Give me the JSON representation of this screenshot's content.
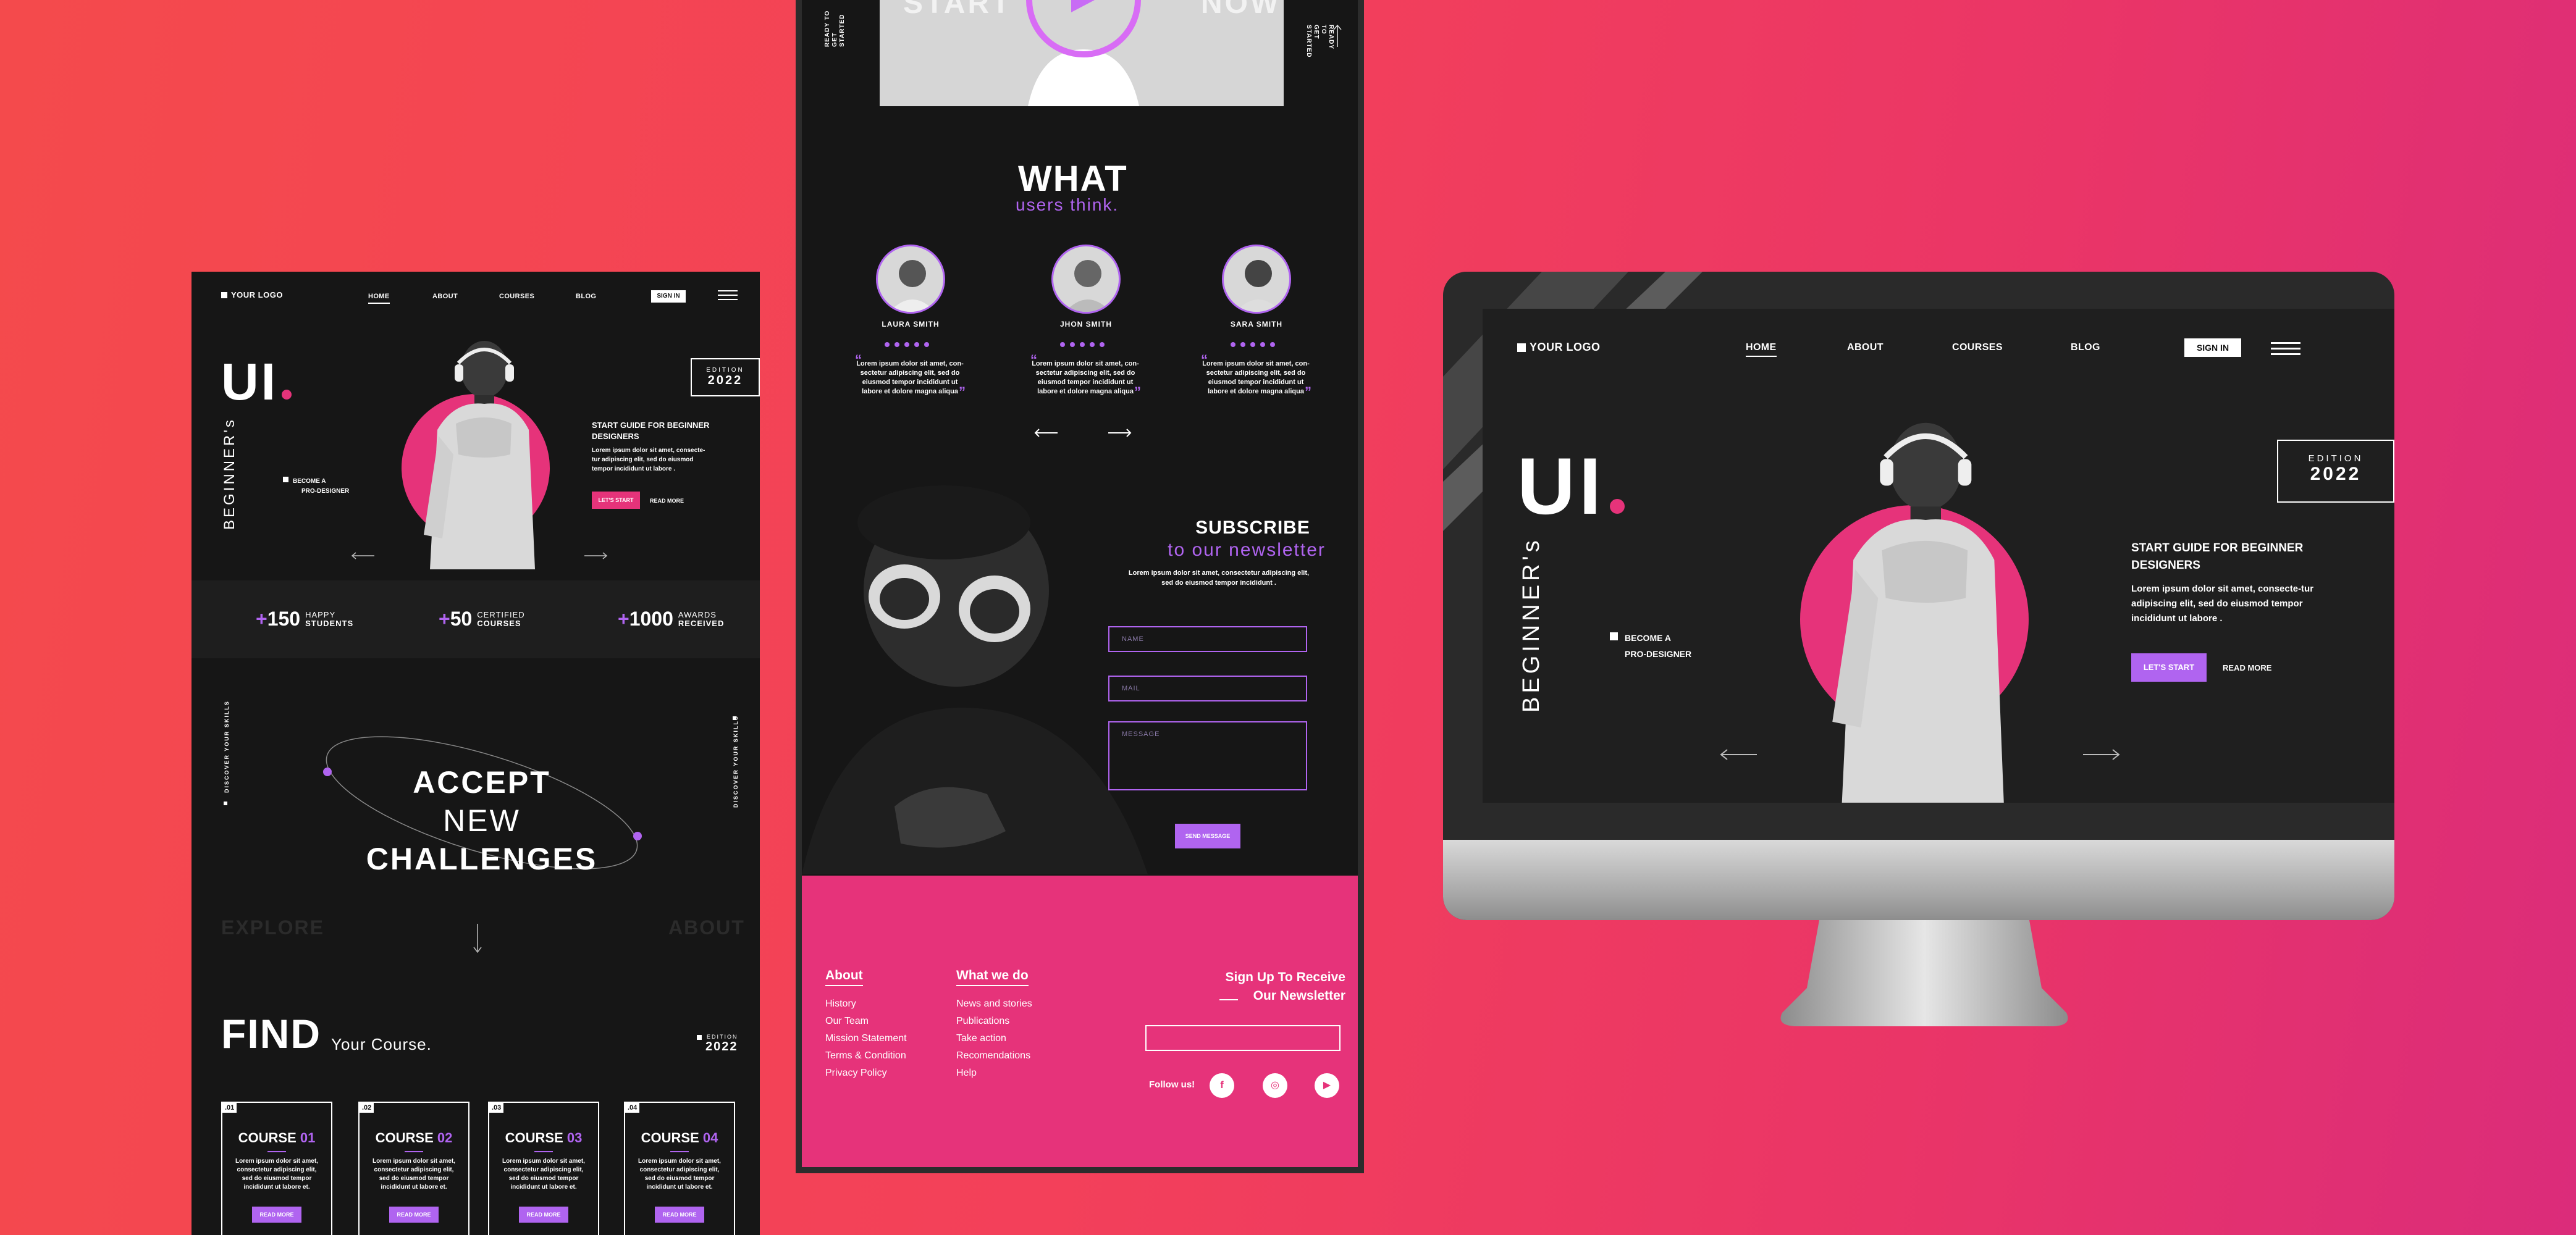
{
  "left": {
    "logo": "YOUR LOGO",
    "nav": [
      "HOME",
      "ABOUT",
      "COURSES",
      "BLOG"
    ],
    "signin": "SIGN IN",
    "hero_title": "UI",
    "vertical_text": "BEGINNER's",
    "become": [
      "BECOME A",
      "PRO-DESIGNER"
    ],
    "edition_label": "EDITION",
    "edition_year": "2022",
    "guide_title": "START GUIDE FOR BEGINNER DESIGNERS",
    "guide_text": "Lorem ipsum dolor sit amet, consecte-tur adipiscing elit, sed do eiusmod tempor incididunt ut labore .",
    "lets_start": "LET'S START",
    "read_more": "READ MORE",
    "stats": [
      {
        "num": "150",
        "l1": "HAPPY",
        "l2": "STUDENTS"
      },
      {
        "num": "50",
        "l1": "CERTIFIED",
        "l2": "COURSES"
      },
      {
        "num": "1000",
        "l1": "AWARDS",
        "l2": "RECEIVED"
      }
    ],
    "side_left": "DISCOVER YOUR SKILLS",
    "side_right": "DISCOVER YOUR SKILLS",
    "accept": [
      "ACCEPT",
      "NEW",
      "CHALLENGES"
    ],
    "explore": "EXPLORE",
    "about": "ABOUT",
    "find": "FIND",
    "your_course": "Your Course.",
    "find_edition_label": "EDITION",
    "find_edition_year": "2022",
    "courses": [
      {
        "no": ".01",
        "name": "COURSE",
        "num": "01",
        "text": "Lorem ipsum dolor sit amet, consectetur adipiscing elit, sed do eiusmod tempor incididunt ut labore et.",
        "btn": "READ MORE"
      },
      {
        "no": ".02",
        "name": "COURSE",
        "num": "02",
        "text": "Lorem ipsum dolor sit amet, consectetur adipiscing elit, sed do eiusmod tempor incididunt ut labore et.",
        "btn": "READ MORE"
      },
      {
        "no": ".03",
        "name": "COURSE",
        "num": "03",
        "text": "Lorem ipsum dolor sit amet, consectetur adipiscing elit, sed do eiusmod tempor incididunt ut labore et.",
        "btn": "READ MORE"
      },
      {
        "no": ".04",
        "name": "COURSE",
        "num": "04",
        "text": "Lorem ipsum dolor sit amet, consectetur adipiscing elit, sed do eiusmod tempor incididunt ut labore et.",
        "btn": "READ MORE"
      }
    ]
  },
  "mid": {
    "top_start": "START",
    "top_now": "NOW",
    "side_top_left": "READY TO GET STARTED",
    "side_top_right": "READY TO GET STARTED",
    "what": "WHAT",
    "users_think": "users think.",
    "testimonials": [
      {
        "name": "LAURA SMITH",
        "text": "Lorem ipsum dolor sit amet, con-sectetur adipiscing elit, sed do eiusmod tempor incididunt ut labore et dolore magna aliqua"
      },
      {
        "name": "JHON SMITH",
        "text": "Lorem ipsum dolor sit amet, con-sectetur adipiscing elit, sed do eiusmod tempor incididunt ut labore et dolore magna aliqua"
      },
      {
        "name": "SARA SMITH",
        "text": "Lorem ipsum dolor sit amet, con-sectetur adipiscing elit, sed do eiusmod tempor incididunt ut labore et dolore magna aliqua"
      }
    ],
    "subscribe": "SUBSCRIBE",
    "newsletter": "to our newsletter",
    "sub_text": "Lorem ipsum dolor sit amet, consectetur adipiscing elit, sed do eiusmod tempor incididunt .",
    "fields": {
      "name": "NAME",
      "mail": "MAIL",
      "message": "MESSAGE"
    },
    "send": "SEND MESSAGE",
    "footer": {
      "about_title": "About",
      "about_links": [
        "History",
        "Our Team",
        "Mission Statement",
        "Terms & Condition",
        "Privacy Policy"
      ],
      "what_title": "What we do",
      "what_links": [
        "News and stories",
        "Publications",
        "Take action",
        "Recomendations",
        "Help"
      ],
      "signup": [
        "Sign Up To Receive",
        "Our Newsletter"
      ],
      "follow": "Follow us!",
      "social": [
        "f",
        "◎",
        "▶"
      ]
    }
  },
  "right": {
    "logo": "YOUR LOGO",
    "nav": [
      "HOME",
      "ABOUT",
      "COURSES",
      "BLOG"
    ],
    "signin": "SIGN IN",
    "hero_title": "UI",
    "vertical_text": "BEGINNER's",
    "become": [
      "BECOME A",
      "PRO-DESIGNER"
    ],
    "edition_label": "EDITION",
    "edition_year": "2022",
    "guide_title": "START GUIDE FOR BEGINNER DESIGNERS",
    "guide_text": "Lorem ipsum dolor sit amet, consecte-tur adipiscing elit, sed do eiusmod tempor incididunt ut labore .",
    "lets_start": "LET'S START",
    "read_more": "READ MORE"
  },
  "colors": {
    "accent_pink": "#e6337a",
    "accent_violet": "#b064f0",
    "background": "#f3405a"
  }
}
